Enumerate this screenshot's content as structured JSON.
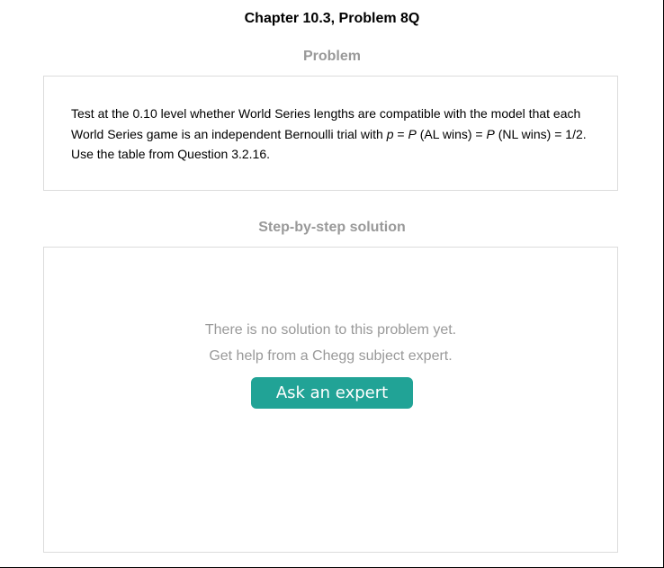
{
  "page": {
    "title": "Chapter 10.3, Problem 8Q"
  },
  "problem": {
    "heading": "Problem",
    "text_part1": "Test at the 0.10 level whether World Series lengths are compatible with the model that each World Series game is an independent Bernoulli trial with ",
    "var_p": "p",
    "eq1": " = ",
    "var_P1": "P",
    "text_part2": " (AL wins) = ",
    "var_P2": "P",
    "text_part3": " (NL wins) = 1/2. Use the table from Question 3.2.16."
  },
  "solution": {
    "heading": "Step-by-step solution",
    "no_solution_line1": "There is no solution to this problem yet.",
    "no_solution_line2": "Get help from a Chegg subject expert.",
    "ask_button_label": "Ask an expert",
    "button_color": "#21a396"
  }
}
